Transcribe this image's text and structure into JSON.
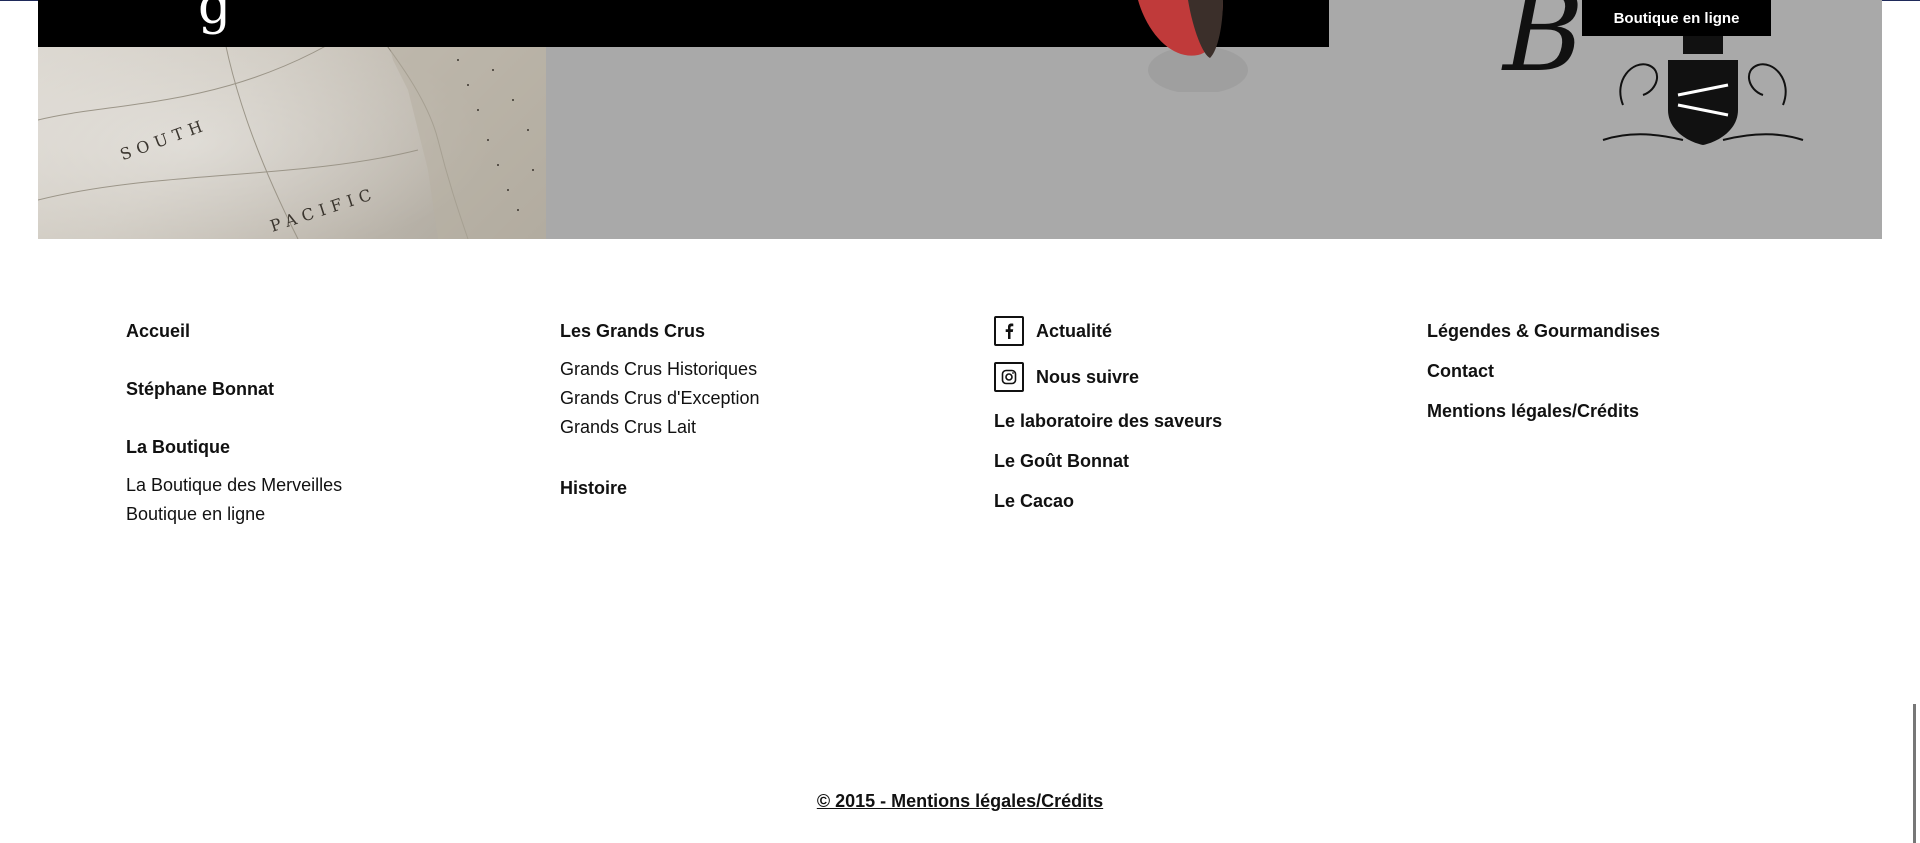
{
  "hero": {
    "map_words": [
      "SOUTH",
      "PACIFIC"
    ],
    "shop_button": "Boutique en ligne",
    "band_glyph": "g",
    "emblem_letter": "B"
  },
  "footer": {
    "col1": {
      "accueil": "Accueil",
      "stephane": "Stéphane Bonnat",
      "boutique": "La Boutique",
      "boutique_items": [
        "La Boutique des Merveilles",
        "Boutique en ligne"
      ]
    },
    "col2": {
      "grands_crus": "Les Grands Crus",
      "items": [
        "Grands Crus Historiques",
        "Grands Crus d'Exception",
        "Grands Crus Lait"
      ],
      "histoire": "Histoire"
    },
    "col3": {
      "actualite": "Actualité",
      "nous_suivre": "Nous suivre",
      "laboratoire": "Le laboratoire des saveurs",
      "gout": "Le Goût Bonnat",
      "cacao": "Le Cacao"
    },
    "col4": {
      "legendes": "Légendes & Gourmandises",
      "contact": "Contact",
      "mentions": "Mentions légales/Crédits"
    }
  },
  "copyright": "© 2015 - Mentions légales/Crédits",
  "icons": {
    "facebook": "facebook-icon",
    "instagram": "instagram-icon"
  },
  "colors": {
    "hero_background": "#a9a9a9",
    "band": "#000000",
    "text": "#111111"
  }
}
